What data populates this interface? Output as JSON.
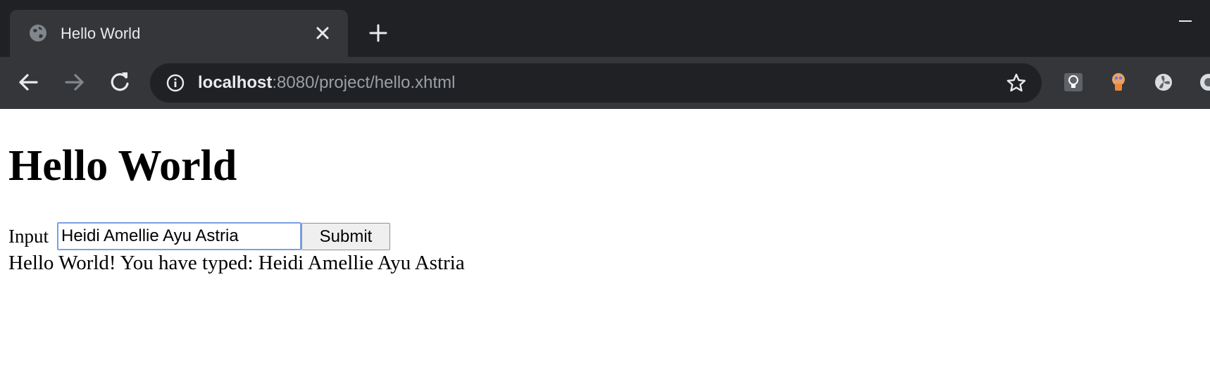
{
  "browser": {
    "tab": {
      "title": "Hello World",
      "favicon": "globe-icon",
      "close_icon": "close-icon"
    },
    "new_tab_icon": "plus-icon",
    "window_controls": {
      "minimize_icon": "minimize-icon"
    },
    "toolbar": {
      "back_icon": "arrow-left-icon",
      "forward_icon": "arrow-right-icon",
      "reload_icon": "reload-icon",
      "site_info_icon": "info-icon",
      "bookmark_icon": "star-icon",
      "extensions": [
        "lightbulb-extension-icon",
        "brain-extension-icon",
        "fan-extension-icon",
        "circle-extension-icon"
      ]
    },
    "address_bar": {
      "host": "localhost",
      "rest": ":8080/project/hello.xhtml"
    }
  },
  "page": {
    "heading": "Hello World",
    "form": {
      "input_label": "Input",
      "input_value": "Heidi Amellie Ayu Astria",
      "submit_label": "Submit"
    },
    "output": "Hello World! You have typed: Heidi Amellie Ayu Astria"
  },
  "colors": {
    "tabstrip_bg": "#202124",
    "toolbar_bg": "#35363a",
    "omnibox_bg": "#202124",
    "input_focus_border": "#7aa0e6"
  }
}
